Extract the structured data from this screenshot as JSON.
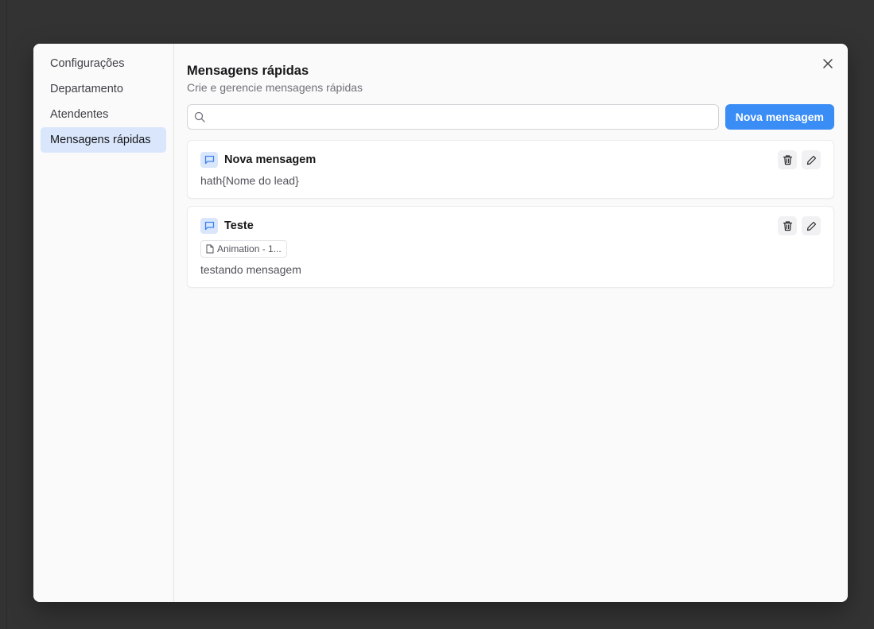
{
  "sidebar": {
    "items": [
      {
        "label": "Configurações",
        "active": false
      },
      {
        "label": "Departamento",
        "active": false
      },
      {
        "label": "Atendentes",
        "active": false
      },
      {
        "label": "Mensagens rápidas",
        "active": true
      }
    ]
  },
  "header": {
    "title": "Mensagens rápidas",
    "subtitle": "Crie e gerencie mensagens rápidas"
  },
  "search": {
    "value": "",
    "placeholder": ""
  },
  "toolbar": {
    "new_label": "Nova mensagem"
  },
  "messages": [
    {
      "title": "Nova mensagem",
      "text": "hath{Nome do lead}",
      "attachment": null
    },
    {
      "title": "Teste",
      "text": "testando mensagem",
      "attachment": "Animation - 1..."
    }
  ],
  "colors": {
    "accent": "#3b8df6",
    "active_nav_bg": "#d9e6fb",
    "backdrop": "#333333"
  },
  "icons": {
    "close": "close-icon",
    "search": "search-icon",
    "message": "message-square-icon",
    "delete": "trash-icon",
    "edit": "pencil-icon",
    "file": "file-icon"
  }
}
